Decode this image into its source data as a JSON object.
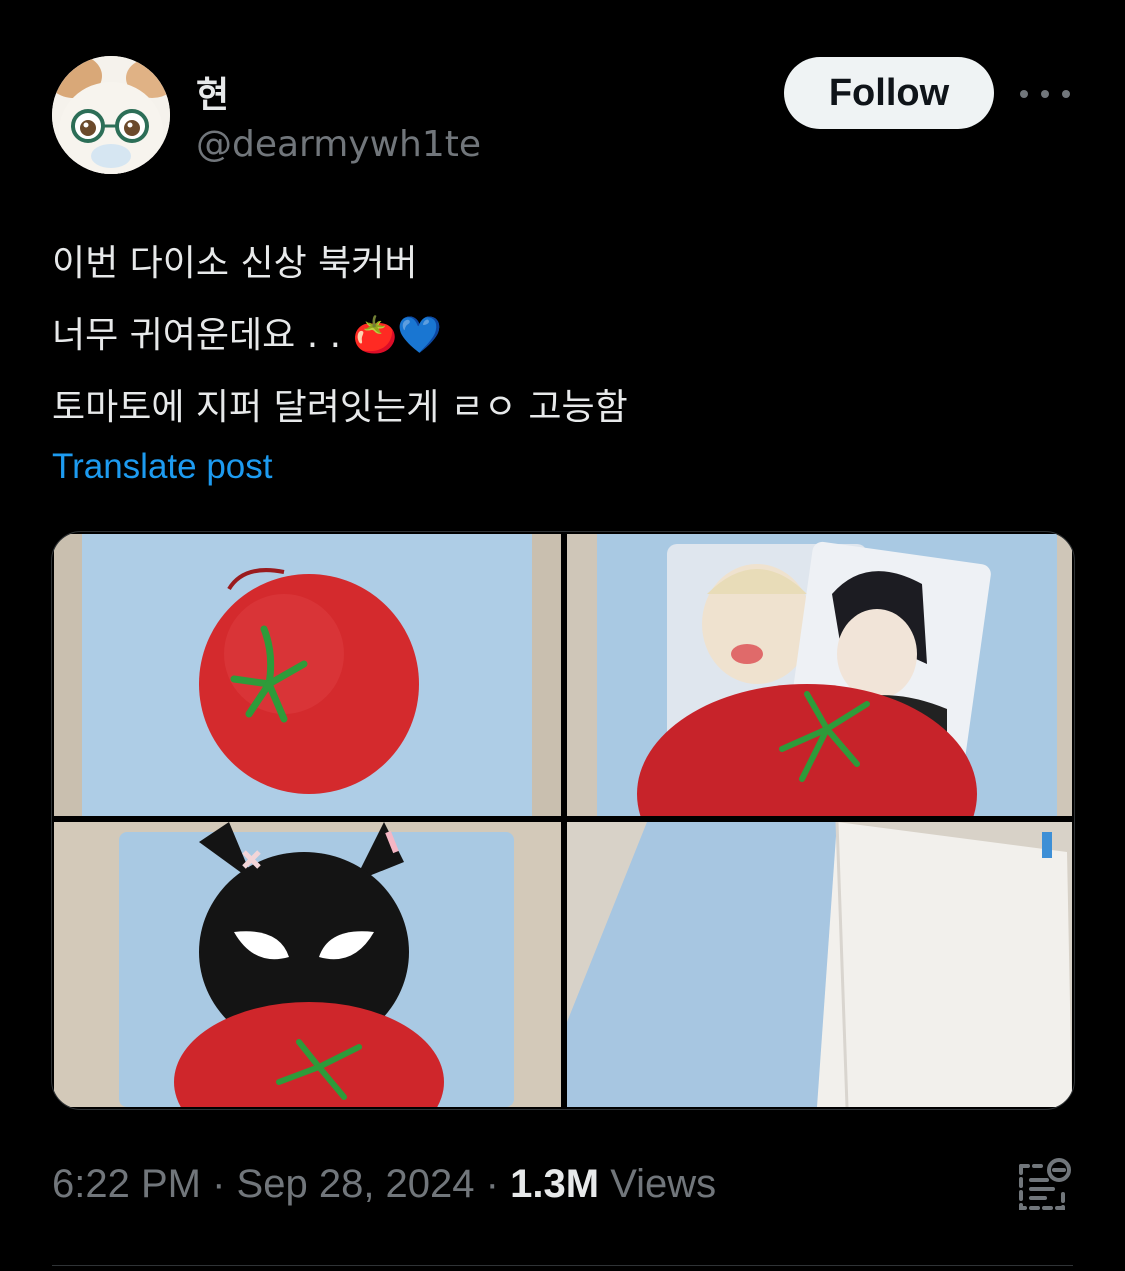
{
  "author": {
    "display_name": "현",
    "handle": "@dearmywh1te",
    "avatar_icon": "avatar-icon"
  },
  "follow_label": "Follow",
  "post": {
    "lines": [
      "이번 다이소 신상 북커버",
      "너무 귀여운데요 . . 🍅💙",
      "토마토에 지퍼 달려잇는게 ㄹㅇ 고능함"
    ]
  },
  "translate_label": "Translate post",
  "meta": {
    "time": "6:22 PM",
    "separator": "·",
    "date": "Sep 28, 2024",
    "views_count": "1.3M",
    "views_label": "Views"
  },
  "colors": {
    "background": "#000000",
    "text": "#e7e9ea",
    "secondary": "#71767b",
    "link": "#1d9bf0",
    "follow_bg": "#eff3f4"
  }
}
